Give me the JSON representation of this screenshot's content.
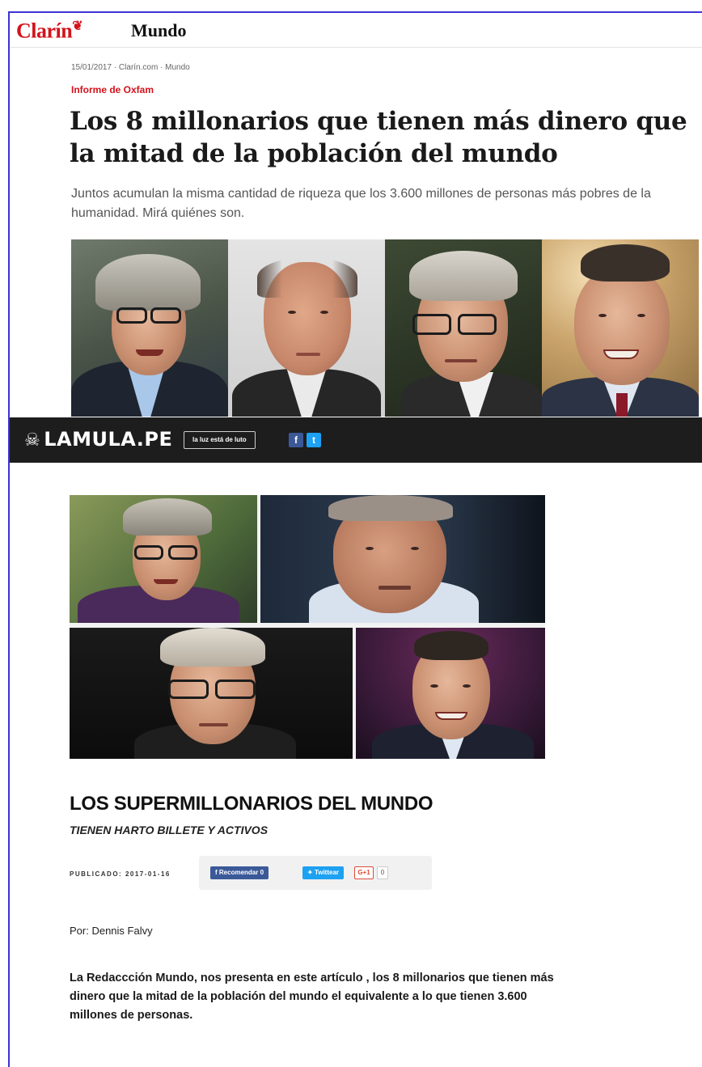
{
  "clarin": {
    "logo": "Clarín",
    "logo_mark": "❦",
    "section": "Mundo",
    "meta": "15/01/2017 · Clarín.com · Mundo",
    "kicker": "Informe de Oxfam",
    "title": "Los 8 millonarios que tienen más dinero que la mitad de la población del mundo",
    "dek": "Juntos acumulan la misma cantidad de riqueza que los 3.600 millones de personas más pobres de la humanidad. Mirá quiénes son."
  },
  "lamula": {
    "logo": "LAMULA.PE",
    "logo_icon": "skull-crossbones-icon",
    "tagline": "la luz está de luto",
    "social": {
      "facebook": "f",
      "twitter": "t"
    },
    "headline": "LOS SUPERMILLONARIOS DEL MUNDO",
    "subheadline": "TIENEN HARTO BILLETE Y ACTIVOS",
    "published_label": "PUBLICADO: 2017-01-16",
    "share": {
      "recommend": "Recomendar 0",
      "tweet": "Twittear",
      "gplus": "G+1",
      "gplus_count": "0"
    },
    "author": "Por: Dennis Falvy",
    "lead": "La Redaccción Mundo, nos presenta en este artículo , los 8 millonarios que tienen más dinero que la mitad de la población del mundo el equivalente a lo que tienen 3.600 millones de personas."
  },
  "colors": {
    "clarin_red": "#d3121b",
    "mula_bar": "#1d1d1d",
    "frame_blue": "#3b34d6",
    "facebook": "#3b5998",
    "twitter": "#1da1f2"
  }
}
